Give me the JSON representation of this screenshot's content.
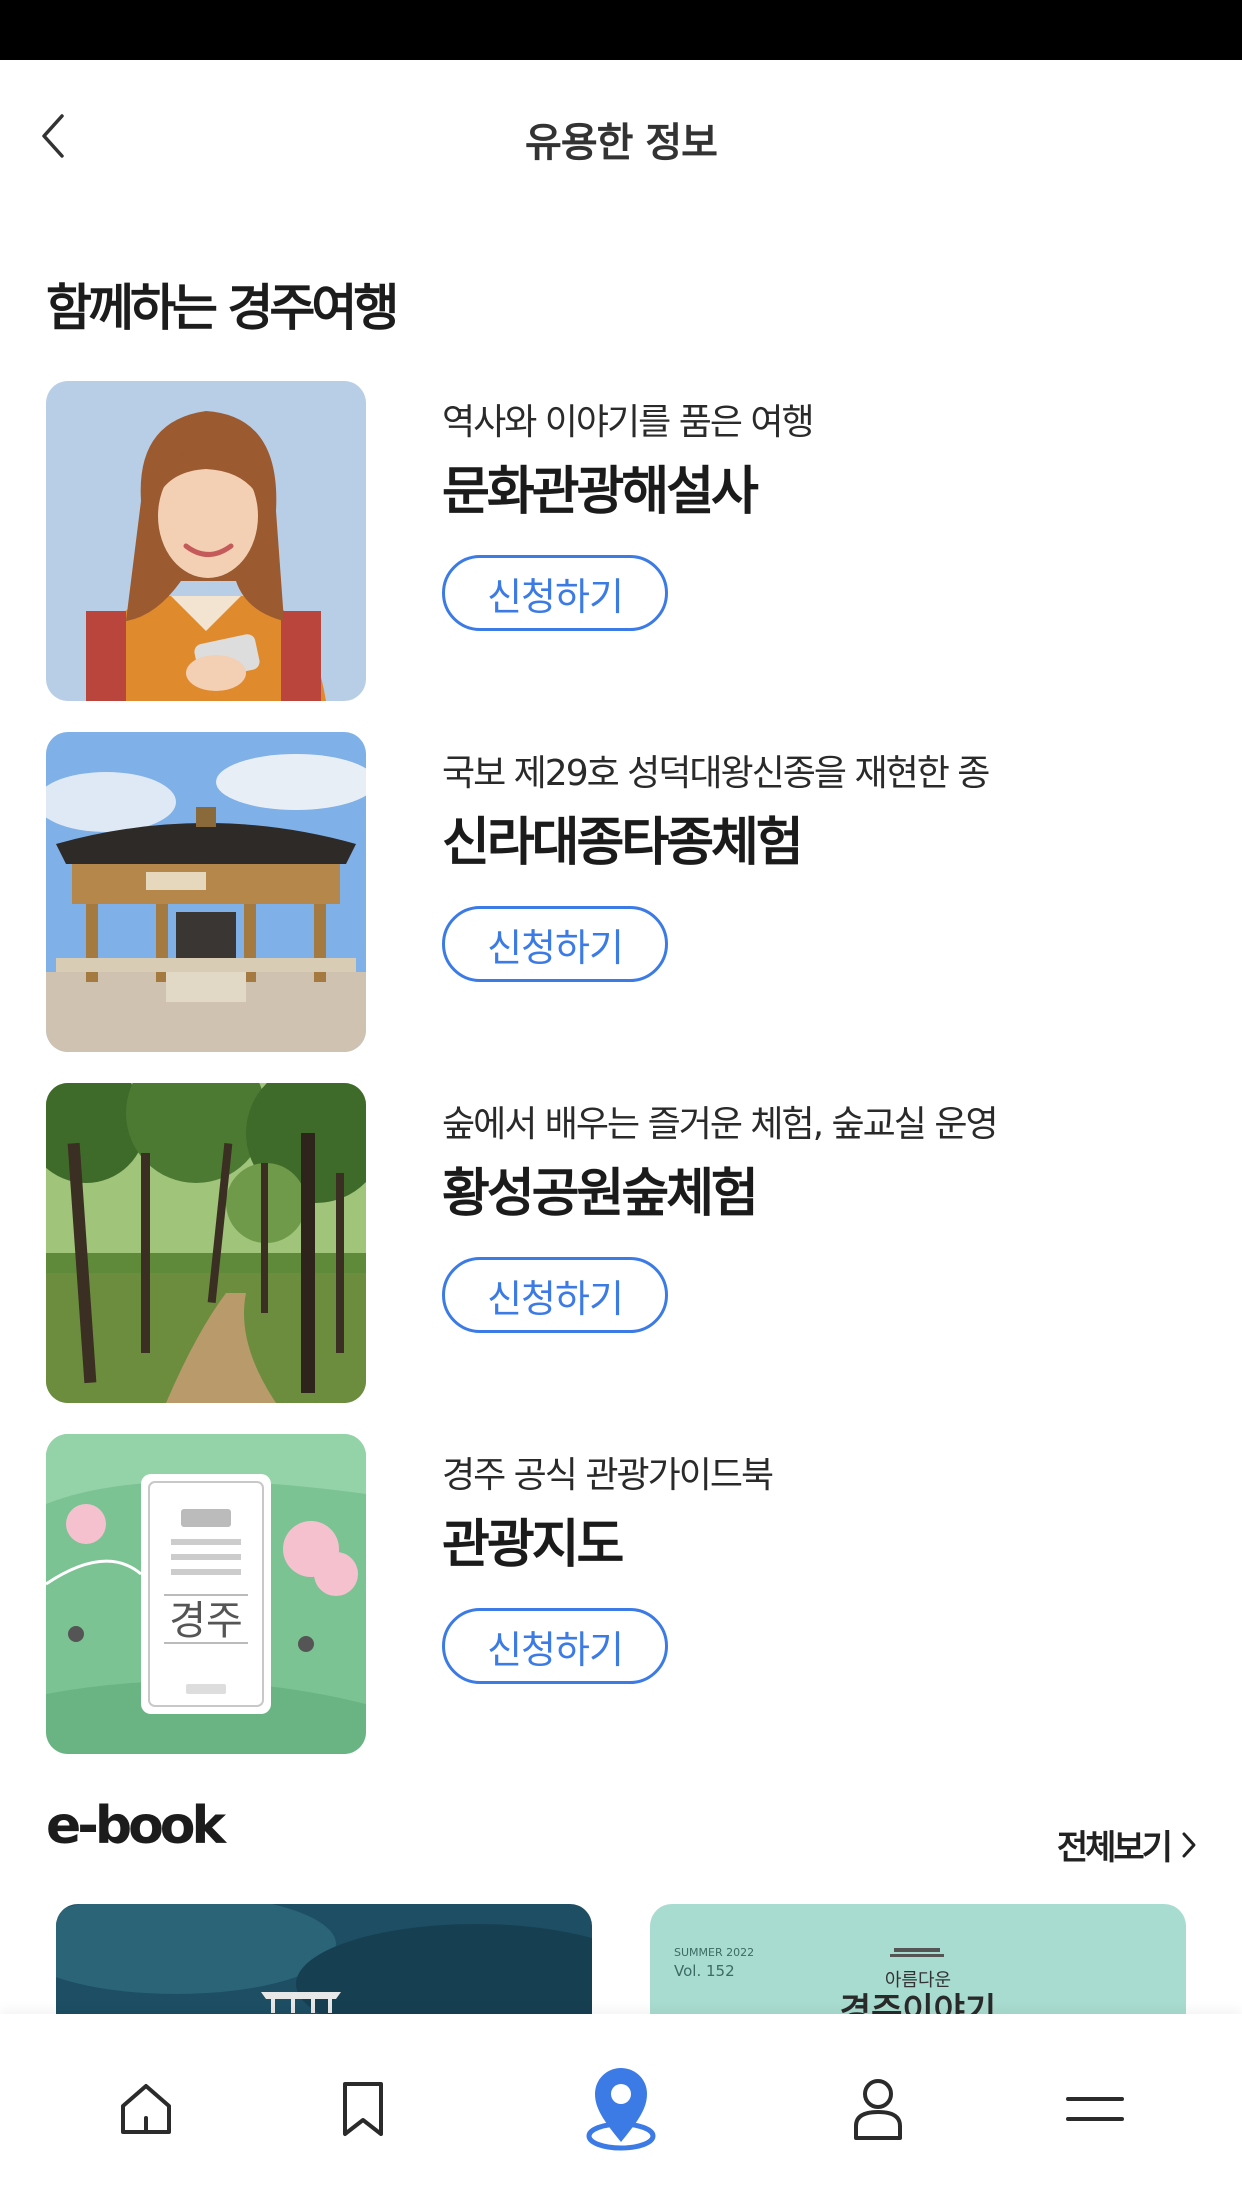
{
  "header": {
    "title": "유용한 정보"
  },
  "section": {
    "title": "함께하는 경주여행"
  },
  "cards": [
    {
      "subtitle": "역사와 이야기를 품은 여행",
      "title": "문화관광해설사",
      "button": "신청하기"
    },
    {
      "subtitle": "국보 제29호 성덕대왕신종을 재현한 종",
      "title": "신라대종타종체험",
      "button": "신청하기"
    },
    {
      "subtitle": "숲에서 배우는 즐거운 체험, 숲교실 운영",
      "title": "황성공원숲체험",
      "button": "신청하기"
    },
    {
      "subtitle": "경주 공식 관광가이드북",
      "title": "관광지도",
      "button": "신청하기"
    }
  ],
  "map_cover": {
    "title": "경주"
  },
  "ebook": {
    "title": "e-book",
    "view_all": "전체보기",
    "items": [
      {
        "label": ""
      },
      {
        "season": "SUMMER 2022",
        "volume": "Vol. 152",
        "brand": "아름다운",
        "title": "경주이야기"
      }
    ]
  },
  "nav": {
    "items": [
      {
        "icon": "home-icon"
      },
      {
        "icon": "bookmark-icon"
      },
      {
        "icon": "location-pin-icon",
        "active": true
      },
      {
        "icon": "user-icon"
      },
      {
        "icon": "menu-icon"
      }
    ],
    "active_color": "#3c7be6",
    "inactive_color": "#2b2b2b"
  },
  "colors": {
    "accent": "#3c7be6"
  }
}
